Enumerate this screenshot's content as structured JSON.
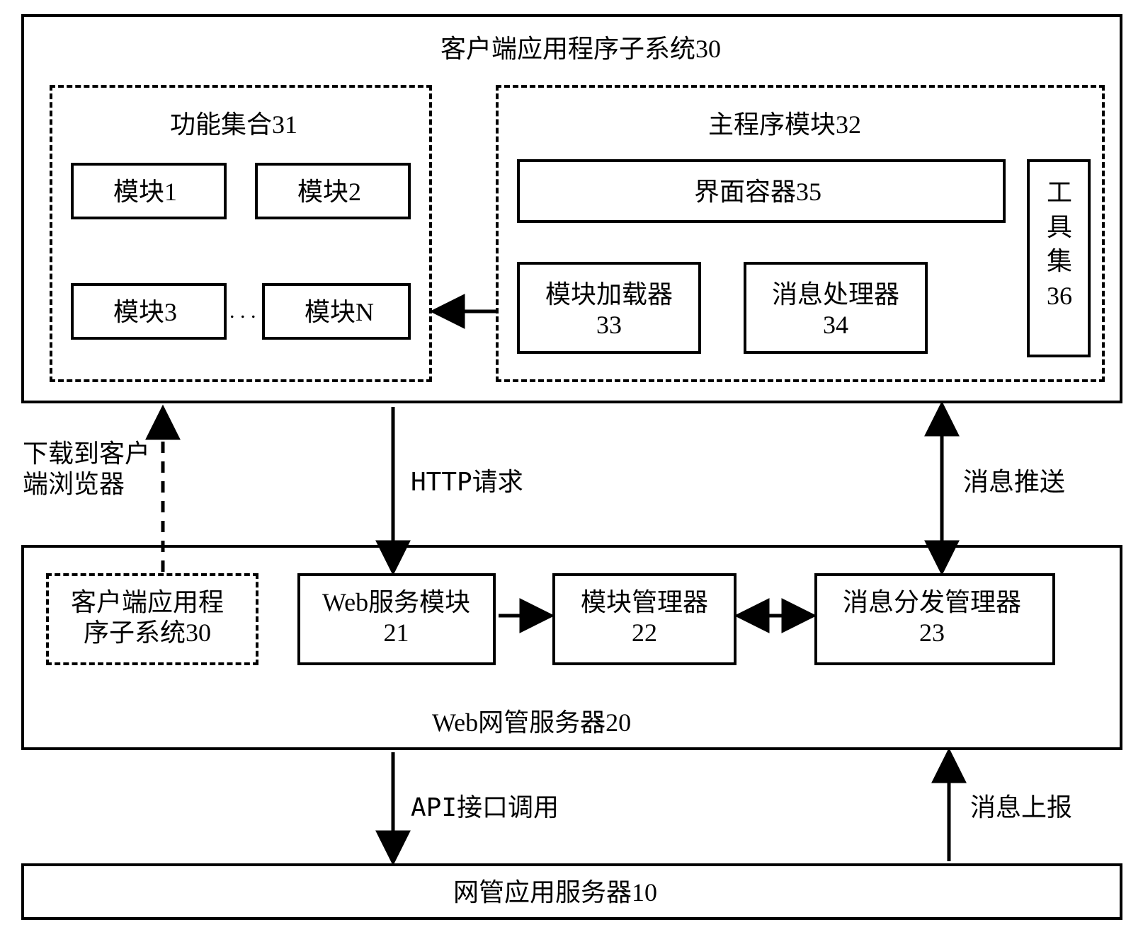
{
  "chart_data": {
    "type": "block-diagram",
    "nodes": [
      {
        "id": "client30",
        "label": "客户端应用程序子系统30",
        "style": "solid"
      },
      {
        "id": "funcset31",
        "label": "功能集合31",
        "style": "dashed",
        "parent": "client30"
      },
      {
        "id": "m1",
        "label": "模块1",
        "style": "solid",
        "parent": "funcset31"
      },
      {
        "id": "m2",
        "label": "模块2",
        "style": "solid",
        "parent": "funcset31"
      },
      {
        "id": "m3",
        "label": "模块3",
        "style": "solid",
        "parent": "funcset31"
      },
      {
        "id": "mN",
        "label": "模块N",
        "style": "solid",
        "parent": "funcset31"
      },
      {
        "id": "ellipsis",
        "label": ". . .",
        "style": "none",
        "parent": "funcset31"
      },
      {
        "id": "main32",
        "label": "主程序模块32",
        "style": "dashed",
        "parent": "client30"
      },
      {
        "id": "ui35",
        "label": "界面容器35",
        "style": "solid",
        "parent": "main32"
      },
      {
        "id": "loader33",
        "label": "模块加载器\n33",
        "style": "solid",
        "parent": "main32"
      },
      {
        "id": "msgproc34",
        "label": "消息处理器\n34",
        "style": "solid",
        "parent": "main32"
      },
      {
        "id": "toolset36",
        "label": "工具集36",
        "style": "solid",
        "parent": "main32"
      },
      {
        "id": "webserver20",
        "label": "Web网管服务器20",
        "style": "solid"
      },
      {
        "id": "client30copy",
        "label": "客户端应用程\n序子系统30",
        "style": "dashed",
        "parent": "webserver20"
      },
      {
        "id": "websvc21",
        "label": "Web服务模块\n21",
        "style": "solid",
        "parent": "webserver20"
      },
      {
        "id": "modmgr22",
        "label": "模块管理器\n22",
        "style": "solid",
        "parent": "webserver20"
      },
      {
        "id": "msgdisp23",
        "label": "消息分发管理器\n23",
        "style": "solid",
        "parent": "webserver20"
      },
      {
        "id": "appsrv10",
        "label": "网管应用服务器10",
        "style": "solid"
      }
    ],
    "edges": [
      {
        "from": "loader33",
        "to": "funcset31",
        "label": "",
        "dir": "one"
      },
      {
        "from": "client30copy",
        "to": "client30",
        "label": "下载到客户\n端浏览器",
        "style": "dashed",
        "dir": "one"
      },
      {
        "from": "client30",
        "to": "websvc21",
        "label": "HTTP请求",
        "dir": "one"
      },
      {
        "from": "client30",
        "to": "msgdisp23",
        "label": "消息推送",
        "dir": "both"
      },
      {
        "from": "websvc21",
        "to": "modmgr22",
        "dir": "one"
      },
      {
        "from": "modmgr22",
        "to": "msgdisp23",
        "dir": "both"
      },
      {
        "from": "websvc21",
        "to": "appsrv10",
        "label": "API接口调用",
        "dir": "one"
      },
      {
        "from": "msgdisp23",
        "to": "appsrv10",
        "label": "消息上报",
        "dir": "one-up"
      }
    ]
  },
  "labels": {
    "client30": "客户端应用程序子系统30",
    "funcset31": "功能集合31",
    "m1": "模块1",
    "m2": "模块2",
    "m3": "模块3",
    "mN": "模块N",
    "ellipsis": ". . .",
    "main32": "主程序模块32",
    "ui35": "界面容器35",
    "loader33": "模块加载器\n33",
    "msgproc34": "消息处理器\n34",
    "toolset36v": "工\n具\n集\n36",
    "webserver20": "Web网管服务器20",
    "client30copy": "客户端应用程\n序子系统30",
    "websvc21": "Web服务模块\n21",
    "modmgr22": "模块管理器\n22",
    "msgdisp23": "消息分发管理器\n23",
    "appsrv10": "网管应用服务器10",
    "edge_download": "下载到客户\n端浏览器",
    "edge_http": "HTTP请求",
    "edge_push": "消息推送",
    "edge_api": "API接口调用",
    "edge_report": "消息上报"
  }
}
